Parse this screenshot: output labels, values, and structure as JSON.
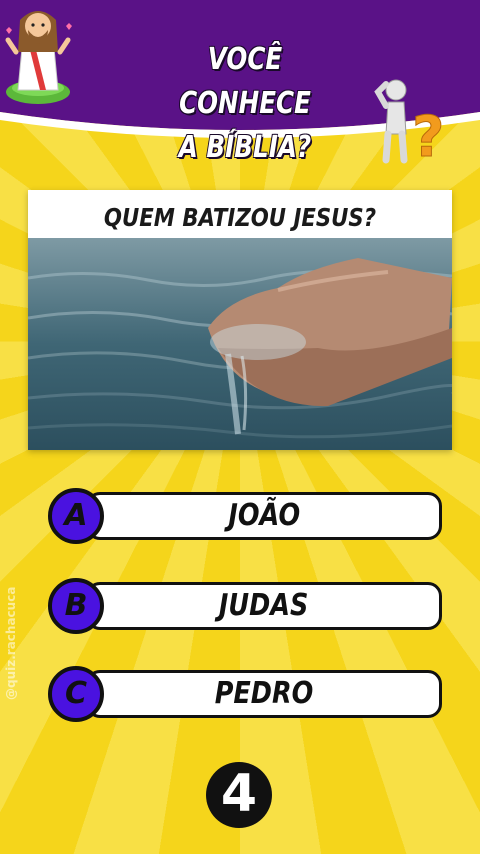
{
  "header": {
    "title_line1": "VOCÊ CONHECE",
    "title_line2": "A BÍBLIA?",
    "accent_color": "#5a1287"
  },
  "question": {
    "text": "QUEM BATIZOU JESUS?",
    "image": "hands-holding-water"
  },
  "answers": [
    {
      "letter": "A",
      "label": "JOÃO"
    },
    {
      "letter": "B",
      "label": "JUDAS"
    },
    {
      "letter": "C",
      "label": "PEDRO"
    }
  ],
  "watermark": "@quiz.rachacuca",
  "timer": {
    "value": "4"
  },
  "colors": {
    "background": "#f3d21a",
    "letter_circle": "#4a12e0",
    "outline": "#111111"
  }
}
